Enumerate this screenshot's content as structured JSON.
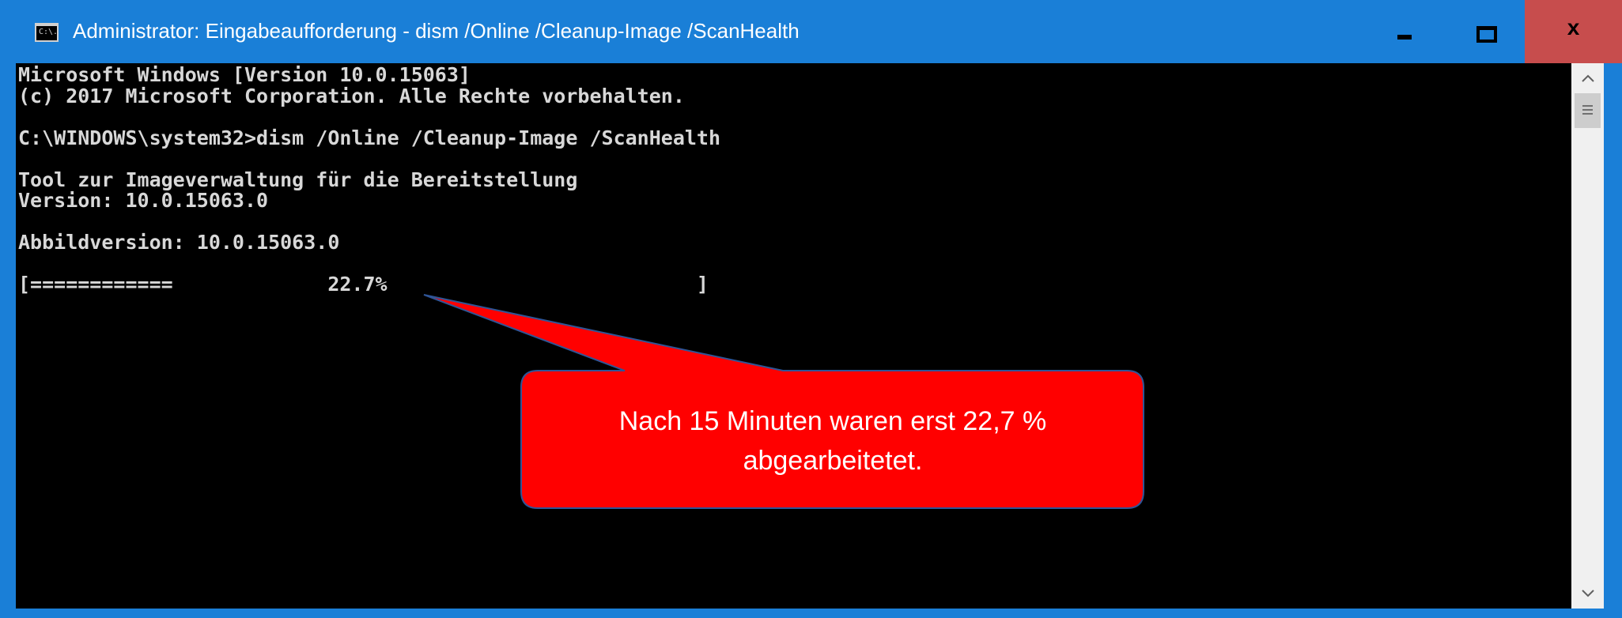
{
  "window": {
    "title": "Administrator: Eingabeaufforderung - dism  /Online /Cleanup-Image /ScanHealth",
    "icon": "cmd-icon",
    "icon_text": "C:\\.",
    "controls": {
      "minimize_icon": "minimize-icon",
      "maximize_icon": "maximize-icon",
      "close_label": "x"
    }
  },
  "console": {
    "lines": [
      "Microsoft Windows [Version 10.0.15063]",
      "(c) 2017 Microsoft Corporation. Alle Rechte vorbehalten.",
      "",
      "C:\\WINDOWS\\system32>dism /Online /Cleanup-Image /ScanHealth",
      "",
      "Tool zur Imageverwaltung für die Bereitstellung",
      "Version: 10.0.15063.0",
      "",
      "Abbildversion: 10.0.15063.0",
      "",
      "[============             22.7%                          ]"
    ],
    "progress_percent": 22.7
  },
  "scrollbar": {
    "up_icon": "chevron-up-icon",
    "down_icon": "chevron-down-icon"
  },
  "annotation": {
    "text_line1": "Nach 15 Minuten waren erst 22,7 %",
    "text_line2": "abgearbeitetet.",
    "fill_color": "#ff0000",
    "border_color": "#2f5597"
  },
  "colors": {
    "titlebar": "#1a7fd7",
    "close_button": "#c74d4d",
    "console_bg": "#000000",
    "console_text": "#d8d8d8"
  }
}
